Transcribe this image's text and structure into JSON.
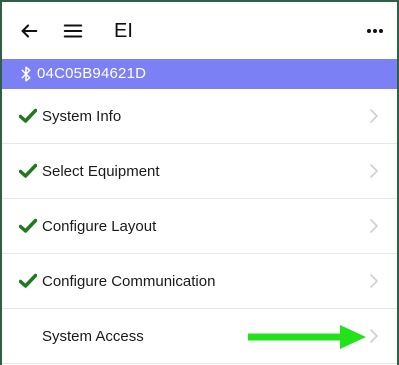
{
  "header": {
    "title": "EI",
    "back_icon": "back-arrow-icon",
    "menu_icon": "hamburger-menu-icon",
    "more_icon": "more-dots-icon"
  },
  "device": {
    "icon": "bluetooth-icon",
    "id": "04C05B94621D",
    "banner_color": "#7b80f4"
  },
  "menu": {
    "items": [
      {
        "label": "System Info",
        "checked": true
      },
      {
        "label": "Select Equipment",
        "checked": true
      },
      {
        "label": "Configure Layout",
        "checked": true
      },
      {
        "label": "Configure Communication",
        "checked": true
      },
      {
        "label": "System Access",
        "checked": false
      }
    ],
    "check_color": "#1f7a1f",
    "chevron_color": "#cfcfcf"
  },
  "annotation": {
    "arrow_color": "#21e21b",
    "points_to": "System Access"
  }
}
